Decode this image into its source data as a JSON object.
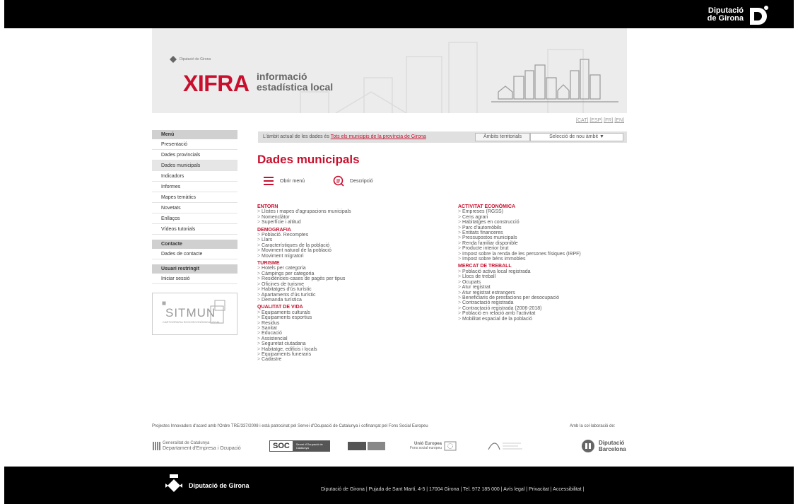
{
  "topbar": {
    "brand_line1": "Diputació",
    "brand_line2": "de Girona"
  },
  "header": {
    "small_brand": "Diputació de Girona",
    "logo": "XIFRA",
    "subtitle_line1": "informació",
    "subtitle_line2": "estadística local"
  },
  "langs": [
    "[CAT]",
    "[ESP]",
    "[FR]",
    "[EN]"
  ],
  "sidebar": {
    "menu_title": "Menú",
    "items": [
      "Presentació",
      "Dades provincials",
      "Dades municipals",
      "Indicadors",
      "Informes",
      "Mapes temàtics",
      "Novetats",
      "Enllaços",
      "Vídeos tutorials"
    ],
    "contact_title": "Contacte",
    "contact_items": [
      "Dades de contacte"
    ],
    "restricted_title": "Usuari restringit",
    "restricted_items": [
      "Iniciar sessió"
    ],
    "sitmun_text": "SITMUN",
    "sitmun_sub": "CARTOGRAFIA SOCIOECONÒMICA LOCAL"
  },
  "scope": {
    "text": "L'àmbit actual de les dades és",
    "link": "Tots els municipis de la província de Girona",
    "territorial_button": "Àmbits territorials",
    "select_button": "Selecció de nou àmbit ▼"
  },
  "main": {
    "title": "Dades municipals",
    "open_menu": "Obrir menú",
    "description": "Descripció"
  },
  "left_column": [
    {
      "title": "ENTORN",
      "items": [
        "Llistes i mapes d'agrupacions municipals",
        "Nomenclàtor",
        "Superfície i altitud"
      ]
    },
    {
      "title": "DEMOGRAFIA",
      "items": [
        "Població. Recomptes",
        "Llars",
        "Característiques de la població",
        "Moviment natural de la població",
        "Moviment migratori"
      ]
    },
    {
      "title": "TURISME",
      "items": [
        "Hotels per categoria",
        "Càmpings per categoria",
        "Residències-cases de pagès per tipus",
        "Oficines de turisme",
        "Habitatges d'ús turístic",
        "Apartaments d'ús turístic",
        "Demanda turística"
      ]
    },
    {
      "title": "QUALITAT DE VIDA",
      "items": [
        "Equipaments culturals",
        "Equipaments esportius",
        "Residus",
        "Sanitat",
        "Educació",
        "Assistencial",
        "Seguretat ciutadana",
        "Habitatge, edificis i locals",
        "Equipaments funeraris",
        "Cadastre"
      ]
    }
  ],
  "right_column": [
    {
      "title": "ACTIVITAT ECONÒMICA",
      "items": [
        "Empreses (RGSS)",
        "Cens agrari",
        "Habitatges en construcció",
        "Parc d'automòbils",
        "Entitats financeres",
        "Pressupostos municipals",
        "Renda familiar disponible",
        "Producte interior brut",
        "Impost sobre la renda de les persones físiques (IRPF)",
        "Impost sobre béns immobles"
      ]
    },
    {
      "title": "MERCAT DE TREBALL",
      "items": [
        "Població activa local registrada",
        "Llocs de treball",
        "Ocupats",
        "Atur registrat",
        "Atur registrat estrangers",
        "Beneficiaris de prestacions per desocupació",
        "Contractació registrada",
        "Contractació registrada (2006-2018)",
        "Població en relació amb l'activitat",
        "Mobilitat espacial de la població"
      ]
    }
  ],
  "footnote": "Projectes Innovadors d'acord amb l'Ordre TRE/337/2008 i està patrocinat pel Servei d'Ocupació de Catalunya i cofinançat pel Fons Social Europeu",
  "footnote_right": "Amb la col·laboració de:",
  "logos": {
    "generalitat_l1": "Generalitat de Catalunya",
    "generalitat_l2": "Departament d'Empresa i Ocupació",
    "soc": "SOC",
    "soc_sub": "Servei d'Ocupació de Catalunya",
    "ue_l1": "Unió Europea",
    "ue_l2": "Fons social europeu",
    "dipbcn_l1": "Diputació",
    "dipbcn_l2": "Barcelona"
  },
  "footer": {
    "brand": "Diputació de Girona",
    "address": "Diputació de Girona | Pujada de Sant Martí, 4-5 | 17004 Girona | Tel. 972 185 000 | Avís legal | Privacitat | Accessibilitat |"
  },
  "colors": {
    "accent": "#c8102e",
    "footer_bg": "#000000",
    "header_bg": "#ececec"
  }
}
